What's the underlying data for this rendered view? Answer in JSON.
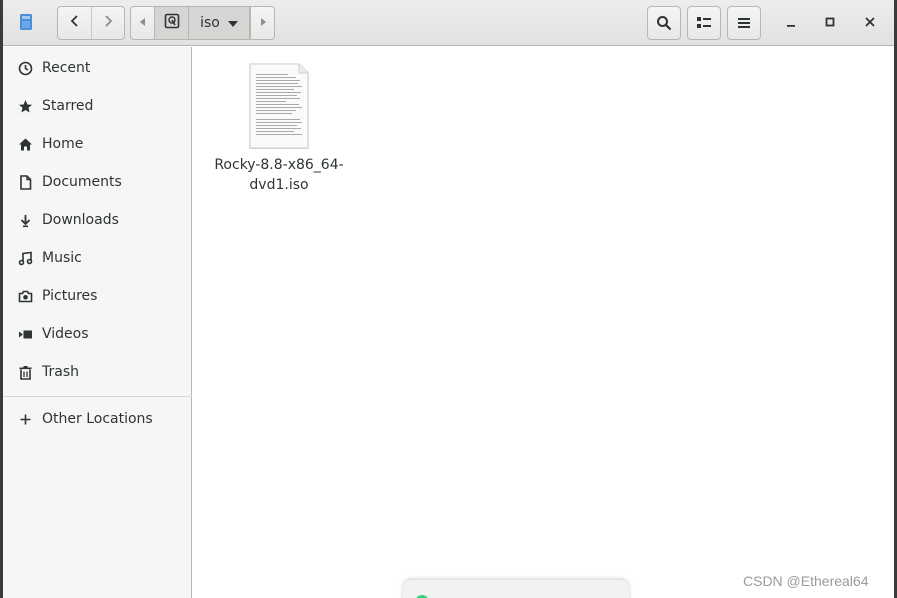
{
  "window": {
    "path": [
      "iso"
    ],
    "current_folder": "iso"
  },
  "toolbar": {
    "back_icon": "chevron-left-icon",
    "forward_icon": "chevron-right-icon",
    "search_icon": "search-icon",
    "view_icon": "list-view-icon",
    "menu_icon": "hamburger-menu-icon"
  },
  "sidebar": {
    "items": [
      {
        "label": "Recent",
        "icon": "clock-icon"
      },
      {
        "label": "Starred",
        "icon": "star-icon"
      },
      {
        "label": "Home",
        "icon": "home-icon"
      },
      {
        "label": "Documents",
        "icon": "document-icon"
      },
      {
        "label": "Downloads",
        "icon": "download-icon"
      },
      {
        "label": "Music",
        "icon": "music-icon"
      },
      {
        "label": "Pictures",
        "icon": "camera-icon"
      },
      {
        "label": "Videos",
        "icon": "video-icon"
      },
      {
        "label": "Trash",
        "icon": "trash-icon"
      }
    ],
    "other_locations": {
      "label": "Other Locations",
      "icon": "plus-icon"
    }
  },
  "files": [
    {
      "name_line1": "Rocky-8.8-x86_64-",
      "name_line2": "dvd1.iso",
      "icon": "text-file-icon"
    }
  ],
  "watermark": "CSDN @Ethereal64",
  "colors": {
    "accent": "#33d17a",
    "sidebar_bg": "#f6f6f5",
    "headerbar_bg": "#e8e8e7"
  }
}
